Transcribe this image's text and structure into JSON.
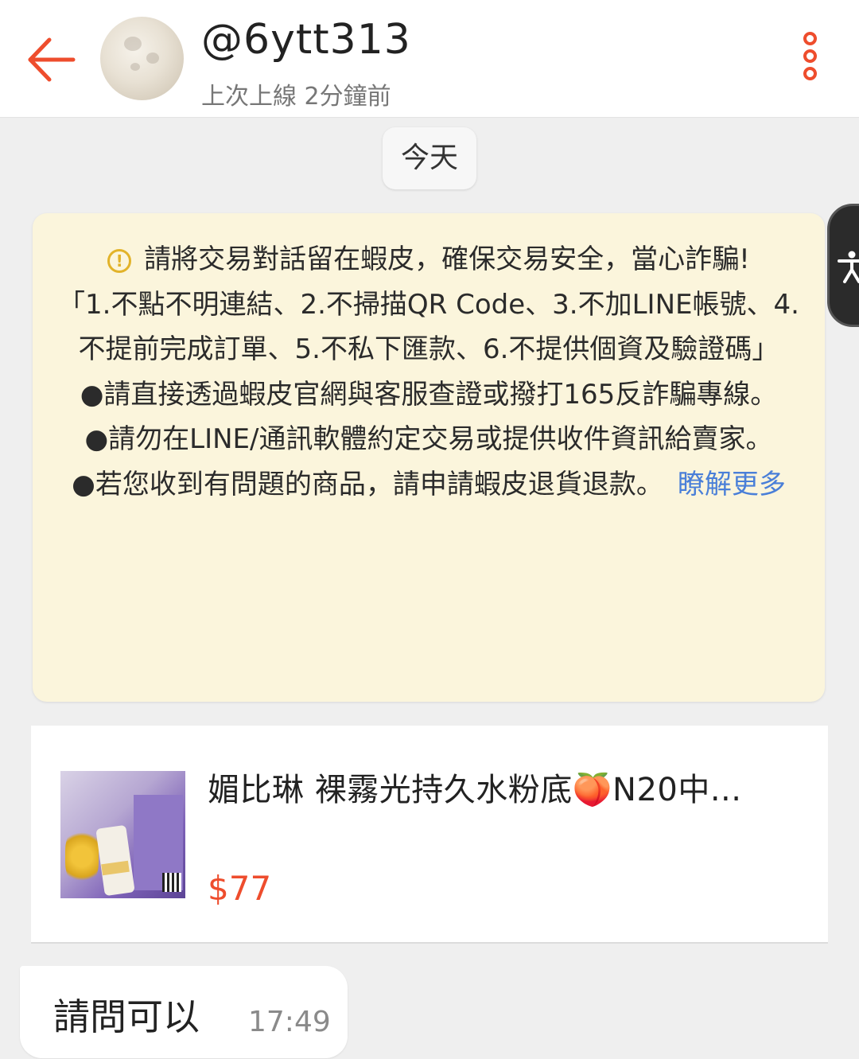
{
  "header": {
    "username": "@6ytt313",
    "last_seen": "上次上線 2分鐘前",
    "back_icon": "arrow-left-icon",
    "more_icon": "more-vertical-icon",
    "accent_color": "#ee4d2d"
  },
  "date_chip": "今天",
  "notice": {
    "line1": "請將交易對話留在蝦皮，確保交易安全，當心詐騙!",
    "line2": "「1.不點不明連結、2.不掃描QR Code、3.不加LINE帳號、4.不提前完成訂單、5.不私下匯款、6.不提供個資及驗證碼」",
    "line3": "●請直接透過蝦皮官網與客服查證或撥打165反詐騙專線。",
    "line4": "●請勿在LINE/通訊軟體約定交易或提供收件資訊給賣家。",
    "line5": "●若您收到有問題的商品，請申請蝦皮退貨退款。",
    "learn_more": "瞭解更多",
    "background_color": "#fbf5dc"
  },
  "product": {
    "title": "媚比琳 裸霧光持久水粉底🍑N20中...",
    "price": "$77"
  },
  "message": {
    "text": "請問可以",
    "time": "17:49"
  },
  "accessibility_icon": "accessibility-icon"
}
